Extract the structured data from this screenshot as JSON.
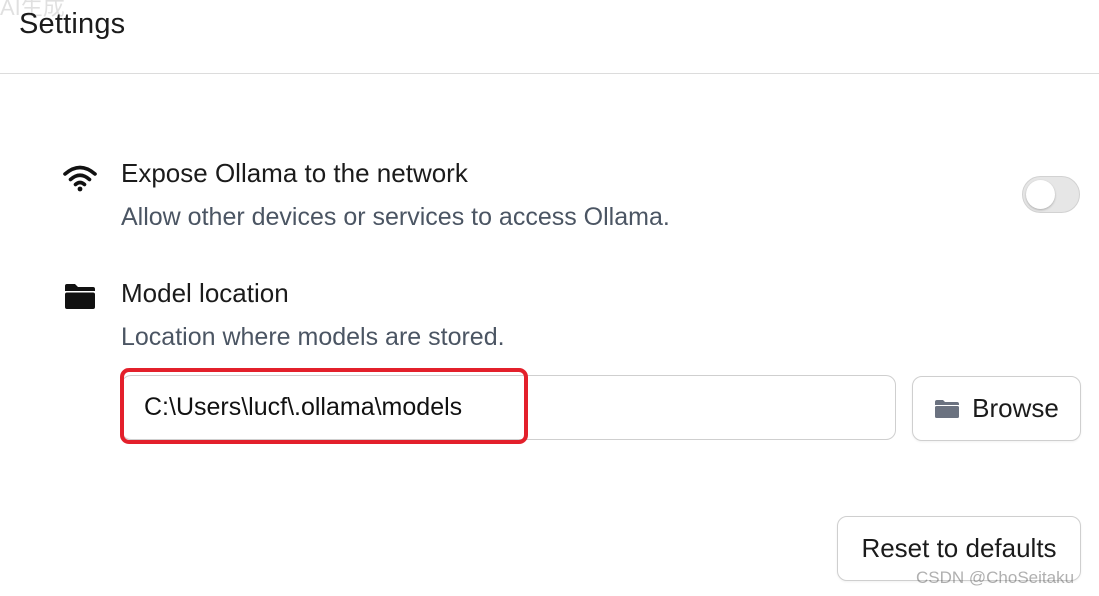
{
  "watermark_top": "AI生成",
  "header": {
    "title": "Settings"
  },
  "network": {
    "icon": "wifi-icon",
    "title": "Expose Ollama to the network",
    "description": "Allow other devices or services to access Ollama.",
    "enabled": false
  },
  "model_location": {
    "icon": "folder-icon",
    "title": "Model location",
    "description": "Location where models are stored.",
    "path_value": "C:\\Users\\lucf\\.ollama\\models",
    "browse_label": "Browse",
    "browse_icon": "folder-icon",
    "highlight_color": "#e3202b"
  },
  "footer": {
    "reset_label": "Reset to defaults"
  },
  "watermark": "CSDN @ChoSeitaku"
}
